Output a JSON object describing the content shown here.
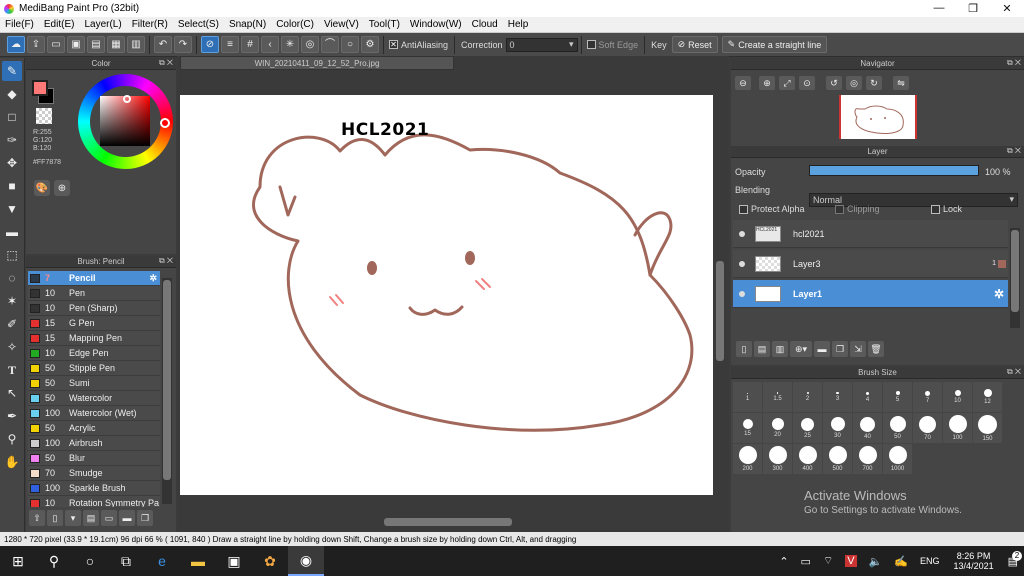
{
  "window": {
    "title": "MediBang Paint Pro (32bit)",
    "minimize": "—",
    "restore": "❐",
    "close": "✕"
  },
  "menu": [
    "File(F)",
    "Edit(E)",
    "Layer(L)",
    "Filter(R)",
    "Select(S)",
    "Snap(N)",
    "Color(C)",
    "View(V)",
    "Tool(T)",
    "Window(W)",
    "Cloud",
    "Help"
  ],
  "toolbar": {
    "antialias_label": "AntiAliasing",
    "correction_label": "Correction",
    "correction_value": "0",
    "softedge_label": "Soft Edge",
    "key_label": "Key",
    "reset_label": "Reset",
    "straight_line_label": "Create a straight line"
  },
  "color_panel": {
    "title": "Color",
    "r": "R:255",
    "g": "G:120",
    "b": "B:120",
    "hex": "#FF7878",
    "primary": "#ff7878",
    "secondary": "#000000"
  },
  "brush_panel": {
    "title": "Brush: Pencil",
    "items": [
      {
        "size": "7",
        "name": "Pencil",
        "color": "#2b3a4a"
      },
      {
        "size": "10",
        "name": "Pen",
        "color": "#333333"
      },
      {
        "size": "10",
        "name": "Pen (Sharp)",
        "color": "#333333"
      },
      {
        "size": "15",
        "name": "G Pen",
        "color": "#e53030"
      },
      {
        "size": "15",
        "name": "Mapping Pen",
        "color": "#e53030"
      },
      {
        "size": "10",
        "name": "Edge Pen",
        "color": "#22aa22"
      },
      {
        "size": "50",
        "name": "Stipple Pen",
        "color": "#f2d200"
      },
      {
        "size": "50",
        "name": "Sumi",
        "color": "#f2d200"
      },
      {
        "size": "50",
        "name": "Watercolor",
        "color": "#6ad0f0"
      },
      {
        "size": "100",
        "name": "Watercolor (Wet)",
        "color": "#6ad0f0"
      },
      {
        "size": "50",
        "name": "Acrylic",
        "color": "#f2d200"
      },
      {
        "size": "100",
        "name": "Airbrush",
        "color": "#cccccc"
      },
      {
        "size": "50",
        "name": "Blur",
        "color": "#f080f0"
      },
      {
        "size": "70",
        "name": "Smudge",
        "color": "#f5dcc8"
      },
      {
        "size": "100",
        "name": "Sparkle Brush",
        "color": "#3060e0"
      },
      {
        "size": "10",
        "name": "Rotation Symmetry Pa",
        "color": "#e53030"
      }
    ]
  },
  "document": {
    "tab": "WIN_20210411_09_12_52_Pro.jpg",
    "canvas_text": "HCL2021",
    "stroke_color": "#a0675a",
    "blush_color": "#f08080"
  },
  "navigator": {
    "title": "Navigator"
  },
  "layer_panel": {
    "title": "Layer",
    "opacity_label": "Opacity",
    "opacity_value": "100 %",
    "opacity": 1.0,
    "blending_label": "Blending",
    "blending_value": "Normal",
    "protect_alpha": "Protect Alpha",
    "clipping": "Clipping",
    "lock": "Lock",
    "layers": [
      {
        "name": "hcl2021",
        "thumb": "HCL2021",
        "selected": false
      },
      {
        "name": "Layer3",
        "thumb": "",
        "selected": false,
        "badge": "1"
      },
      {
        "name": "Layer1",
        "thumb": "",
        "selected": true
      }
    ]
  },
  "brush_size_panel": {
    "title": "Brush Size",
    "sizes": [
      "1",
      "1.5",
      "2",
      "3",
      "4",
      "5",
      "7",
      "10",
      "12",
      "15",
      "20",
      "25",
      "30",
      "40",
      "50",
      "70",
      "100",
      "150",
      "200",
      "300",
      "400",
      "500",
      "700",
      "1000"
    ]
  },
  "watermark": {
    "line1": "Activate Windows",
    "line2": "Go to Settings to activate Windows."
  },
  "statusbar": {
    "text": "1280 * 720 pixel  (33.9 * 19.1cm)  96 dpi  66 %  ( 1091, 840 )  Draw a straight line by holding down Shift, Change a brush size by holding down Ctrl, Alt, and dragging"
  },
  "taskbar": {
    "lang": "ENG",
    "time": "8:26 PM",
    "date": "13/4/2021",
    "notif": "2"
  }
}
